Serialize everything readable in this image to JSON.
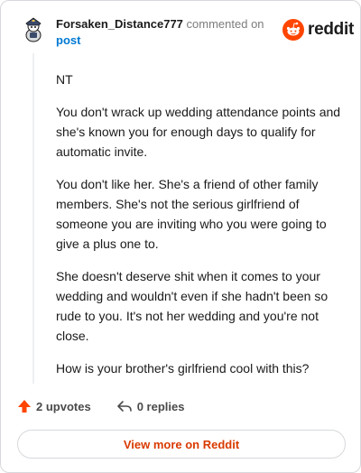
{
  "comment": {
    "author": "Forsaken_Distance777",
    "action_text": "commented on",
    "target_link": "post",
    "paragraphs": [
      "NT",
      "You don't wrack up wedding attendance points and she's known you for enough days to qualify for automatic invite.",
      "You don't like her. She's a friend of other family members. She's not the serious girlfriend of someone you are inviting who you were going to give a plus one to.",
      "She doesn't deserve shit when it comes to your wedding and wouldn't even if she hadn't been so rude to you. It's not her wedding and you're not close.",
      "How is your brother's girlfriend cool with this?"
    ]
  },
  "logo": {
    "wordmark": "reddit",
    "icon": "reddit-snoo-icon"
  },
  "footer": {
    "upvotes": "2 upvotes",
    "replies": "0 replies",
    "upvote_icon": "upvote-arrow-icon",
    "reply_icon": "reply-arrow-icon",
    "view_more": "View more on Reddit"
  },
  "colors": {
    "brand": "#ff4500",
    "link": "#0079d3",
    "view_more_text": "#d93a00"
  }
}
